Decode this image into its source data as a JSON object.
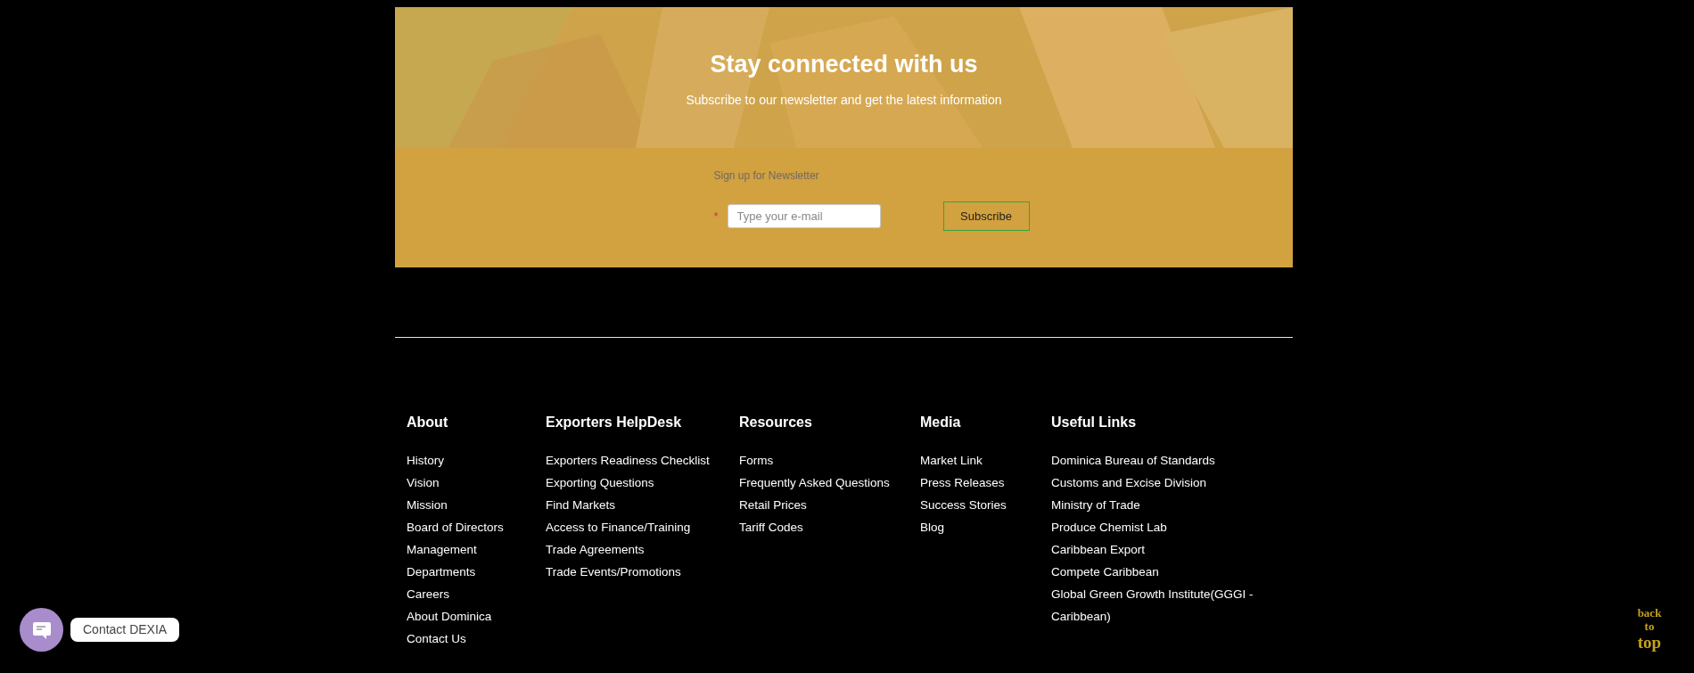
{
  "newsletter": {
    "title": "Stay connected with us",
    "subtitle": "Subscribe to our newsletter and get the latest information",
    "form_label": "Sign up for Newsletter",
    "required_mark": "*",
    "email": {
      "placeholder": "Type your e-mail"
    },
    "button": "Subscribe"
  },
  "footer": {
    "columns": [
      {
        "heading": "About",
        "links": [
          "History",
          "Vision",
          "Mission",
          "Board of Directors",
          "Management",
          "Departments",
          "Careers",
          "About Dominica",
          "Contact Us"
        ]
      },
      {
        "heading": "Exporters HelpDesk",
        "links": [
          "Exporters Readiness Checklist",
          "Exporting Questions",
          "Find Markets",
          "Access to Finance/Training",
          "Trade Agreements",
          "Trade Events/Promotions"
        ]
      },
      {
        "heading": "Resources",
        "links": [
          "Forms",
          "Frequently Asked Questions",
          "Retail Prices",
          "Tariff Codes"
        ]
      },
      {
        "heading": "Media",
        "links": [
          "Market Link",
          "Press Releases",
          "Success Stories",
          "Blog"
        ]
      },
      {
        "heading": "Useful Links",
        "links": [
          "Dominica Bureau of Standards",
          "Customs and Excise Division",
          "Ministry of Trade",
          "Produce Chemist Lab",
          "Caribbean Export",
          "Compete Caribbean",
          "Global Green Growth Institute(GGGI - Caribbean)"
        ]
      }
    ]
  },
  "chat": {
    "label": "Contact DEXIA"
  },
  "back_to_top": [
    "back",
    "to",
    "top"
  ]
}
